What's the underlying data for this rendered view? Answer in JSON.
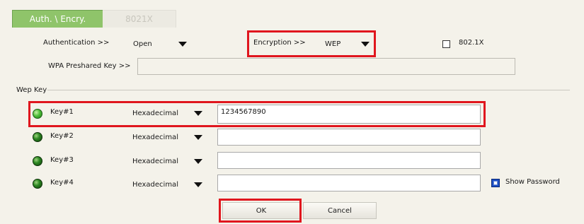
{
  "tabs": {
    "active": "Auth. \\ Encry.",
    "inactive": "8021X"
  },
  "auth": {
    "label": "Authentication >>",
    "value": "Open"
  },
  "encryption": {
    "label": "Encryption >>",
    "value": "WEP"
  },
  "dot1x": {
    "label": "802.1X",
    "checked": false
  },
  "wpa": {
    "label": "WPA Preshared Key >>",
    "value": ""
  },
  "wep_group": {
    "label": "Wep Key"
  },
  "keys": [
    {
      "label": "Key#1",
      "format": "Hexadecimal",
      "value": "1234567890",
      "selected": true
    },
    {
      "label": "Key#2",
      "format": "Hexadecimal",
      "value": "",
      "selected": false
    },
    {
      "label": "Key#3",
      "format": "Hexadecimal",
      "value": "",
      "selected": false
    },
    {
      "label": "Key#4",
      "format": "Hexadecimal",
      "value": "",
      "selected": false
    }
  ],
  "show_password": {
    "label": "Show Password",
    "checked": true
  },
  "buttons": {
    "ok": "OK",
    "cancel": "Cancel"
  },
  "colors": {
    "highlight": "#e0161e",
    "tab_active": "#8fc46a"
  }
}
